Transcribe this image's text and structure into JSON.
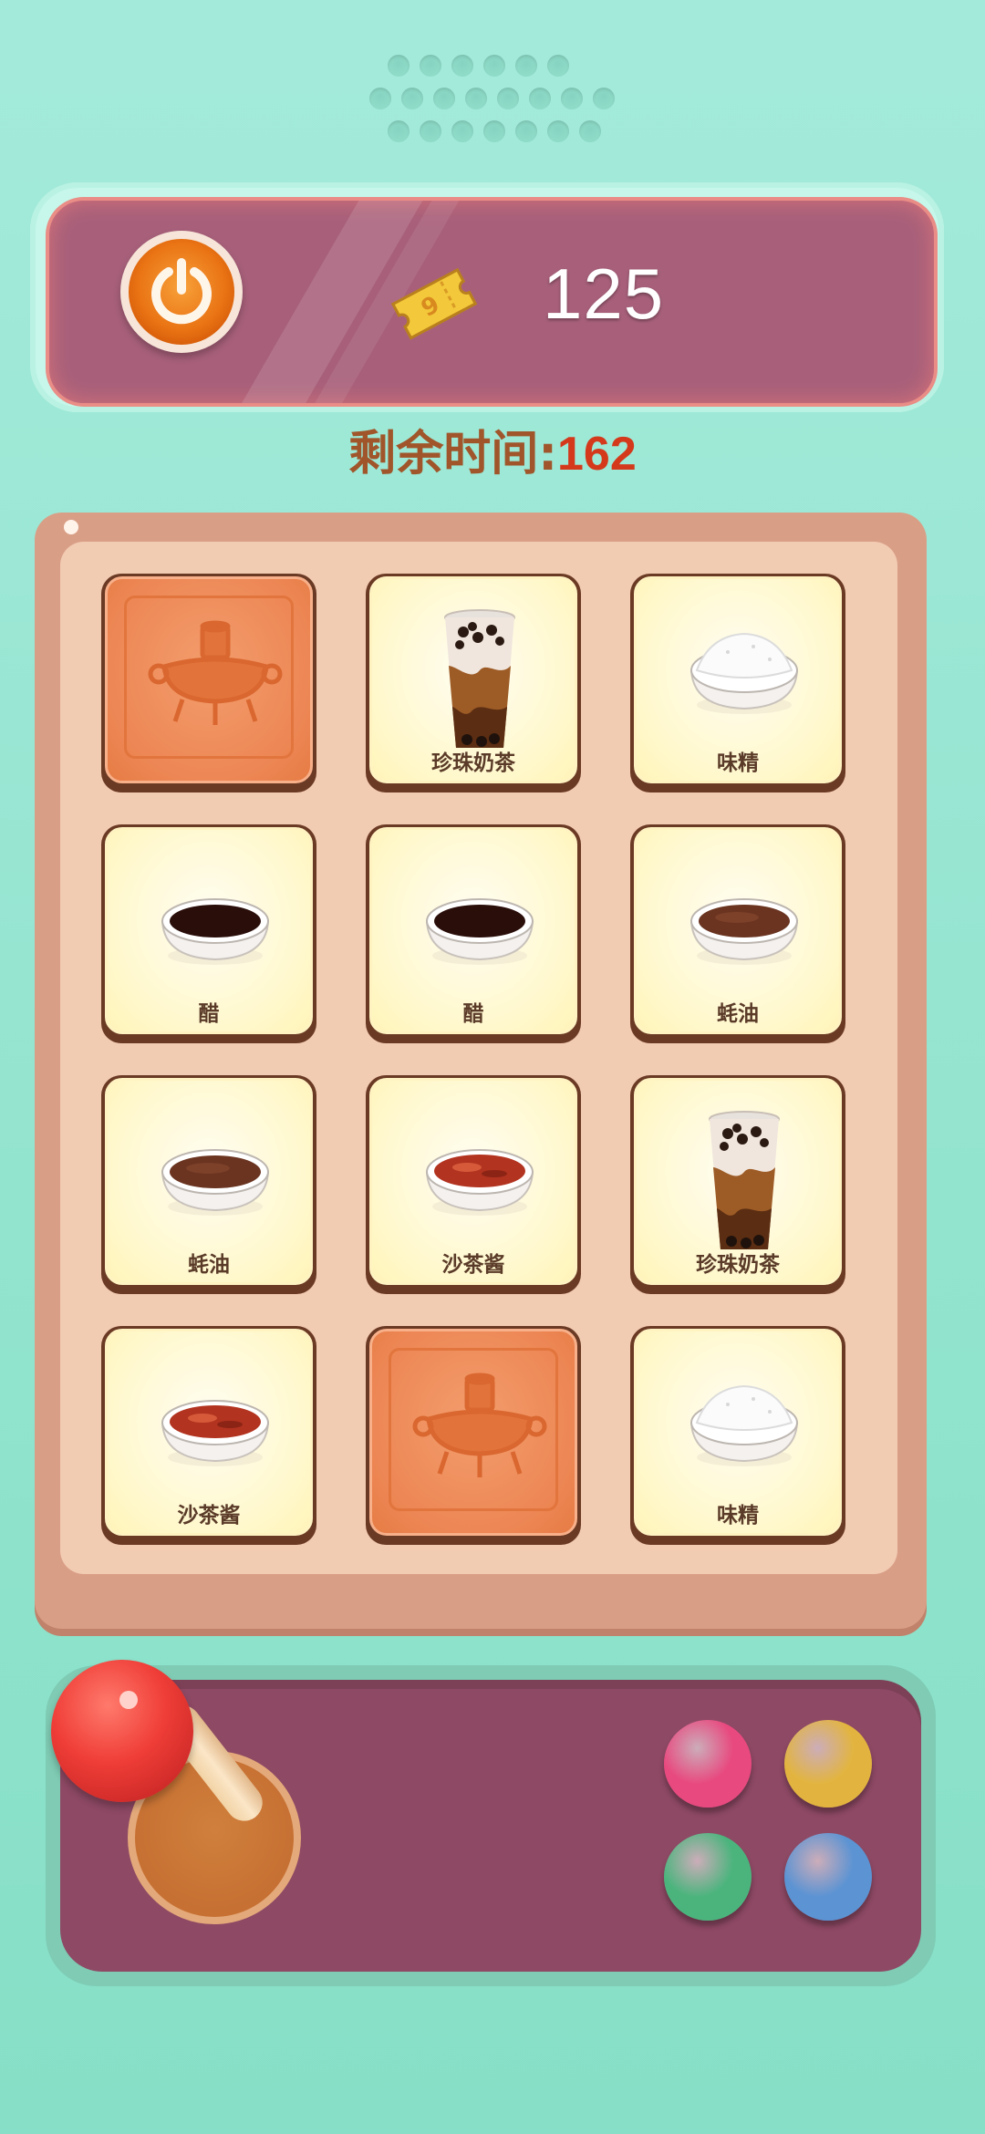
{
  "header": {
    "power_icon": "power-icon",
    "ticket_icon": "ticket-icon",
    "coins": "125"
  },
  "timer": {
    "label": "剩余时间:",
    "value": "162"
  },
  "board": {
    "cards": [
      {
        "state": "hidden",
        "label": "",
        "icon": "hotpot-icon"
      },
      {
        "state": "revealed",
        "label": "珍珠奶茶",
        "icon": "bubble-tea-icon"
      },
      {
        "state": "revealed",
        "label": "味精",
        "icon": "msg-icon"
      },
      {
        "state": "revealed",
        "label": "醋",
        "icon": "vinegar-icon"
      },
      {
        "state": "revealed",
        "label": "醋",
        "icon": "vinegar-icon"
      },
      {
        "state": "revealed",
        "label": "蚝油",
        "icon": "oyster-sauce-icon"
      },
      {
        "state": "revealed",
        "label": "蚝油",
        "icon": "oyster-sauce-icon"
      },
      {
        "state": "revealed",
        "label": "沙茶酱",
        "icon": "satay-sauce-icon"
      },
      {
        "state": "revealed",
        "label": "珍珠奶茶",
        "icon": "bubble-tea-icon"
      },
      {
        "state": "revealed",
        "label": "沙茶酱",
        "icon": "satay-sauce-icon"
      },
      {
        "state": "hidden",
        "label": "",
        "icon": "hotpot-icon"
      },
      {
        "state": "revealed",
        "label": "味精",
        "icon": "msg-icon"
      }
    ]
  },
  "controller": {
    "buttons": [
      {
        "name": "pink",
        "color": "#e8497f"
      },
      {
        "name": "yellow",
        "color": "#e2b43f"
      },
      {
        "name": "green",
        "color": "#4bb47d"
      },
      {
        "name": "blue",
        "color": "#5b93d3"
      }
    ]
  }
}
